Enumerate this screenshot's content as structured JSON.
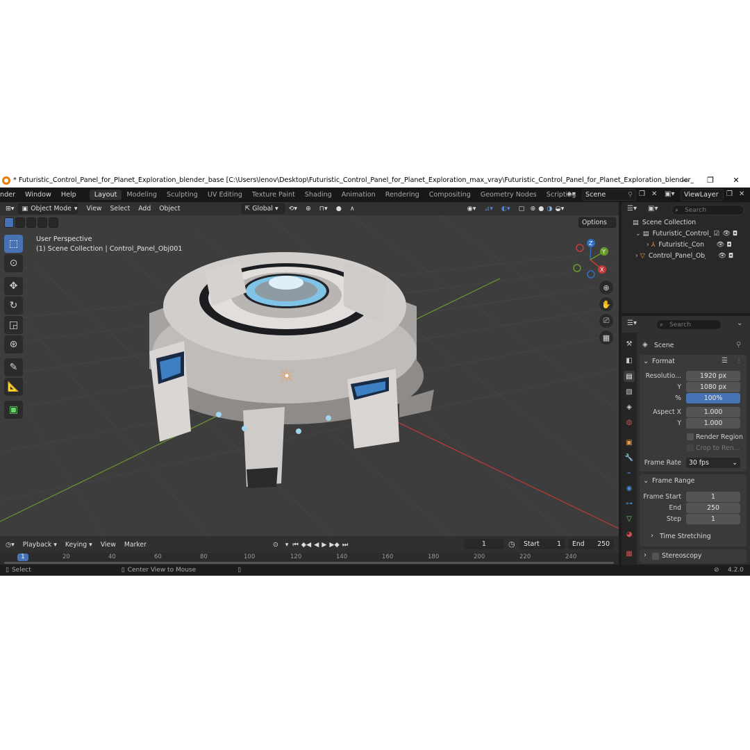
{
  "window": {
    "title": "* Futuristic_Control_Panel_for_Planet_Exploration_blender_base [C:\\Users\\lenov\\Desktop\\Futuristic_Control_Panel_for_Planet_Exploration_max_vray\\Futuristic_Control_Panel_for_Planet_Exploration_blender_base.blend] - Blend...",
    "minimize": "—",
    "restore": "❐",
    "close": "✕"
  },
  "menu": {
    "items": [
      "nder",
      "Window",
      "Help"
    ],
    "workspaces": [
      "Layout",
      "Modeling",
      "Sculpting",
      "UV Editing",
      "Texture Paint",
      "Shading",
      "Animation",
      "Rendering",
      "Compositing",
      "Geometry Nodes",
      "Scripting"
    ],
    "active_workspace": "Layout",
    "add_tab": "+",
    "scene": "Scene",
    "view_layer": "ViewLayer"
  },
  "viewport": {
    "mode": "Object Mode",
    "menus": [
      "View",
      "Select",
      "Add",
      "Object"
    ],
    "orientation": "Global",
    "options": "Options",
    "perspective_label": "User Perspective",
    "collection_label": "(1) Scene Collection | Control_Panel_Obj001",
    "gizmo_axes": {
      "z": "Z",
      "y": "Y",
      "x": "X"
    },
    "colors": {
      "background": "#3d3d3d",
      "x_axis": "#c43b3b",
      "y_axis": "#6a9a2d",
      "active_tool": "#4772b3"
    }
  },
  "outliner": {
    "search_placeholder": "Search",
    "rows": [
      {
        "label": "Scene Collection"
      },
      {
        "label": "Futuristic_Control_"
      },
      {
        "label": "Futuristic_Cont"
      },
      {
        "label": "Control_Panel_Obj("
      }
    ]
  },
  "properties": {
    "search_placeholder": "Search",
    "breadcrumb": "Scene",
    "format": {
      "title": "Format",
      "resolution_label": "Resolutio...",
      "resolution_x": "1920 px",
      "y_label": "Y",
      "resolution_y": "1080 px",
      "percent_label": "%",
      "percent": "100%",
      "aspect_x_label": "Aspect X",
      "aspect_x": "1.000",
      "aspect_y_label": "Y",
      "aspect_y": "1.000",
      "render_region": "Render Region",
      "crop": "Crop to Ren...",
      "frame_rate_label": "Frame Rate",
      "frame_rate": "30 fps"
    },
    "frame_range": {
      "title": "Frame Range",
      "start_label": "Frame Start",
      "start": "1",
      "end_label": "End",
      "end": "250",
      "step_label": "Step",
      "step": "1",
      "time_stretching": "Time Stretching"
    },
    "stereoscopy": "Stereoscopy"
  },
  "timeline": {
    "menus": [
      "Playback",
      "Keying",
      "View",
      "Marker"
    ],
    "current_frame": "1",
    "start_label": "Start",
    "start": "1",
    "end_label": "End",
    "end": "250",
    "ruler_marks": [
      "1",
      "20",
      "40",
      "60",
      "80",
      "100",
      "120",
      "140",
      "160",
      "180",
      "200",
      "220",
      "240"
    ]
  },
  "status": {
    "select": "Select",
    "center_view": "Center View to Mouse",
    "version": "4.2.0"
  }
}
